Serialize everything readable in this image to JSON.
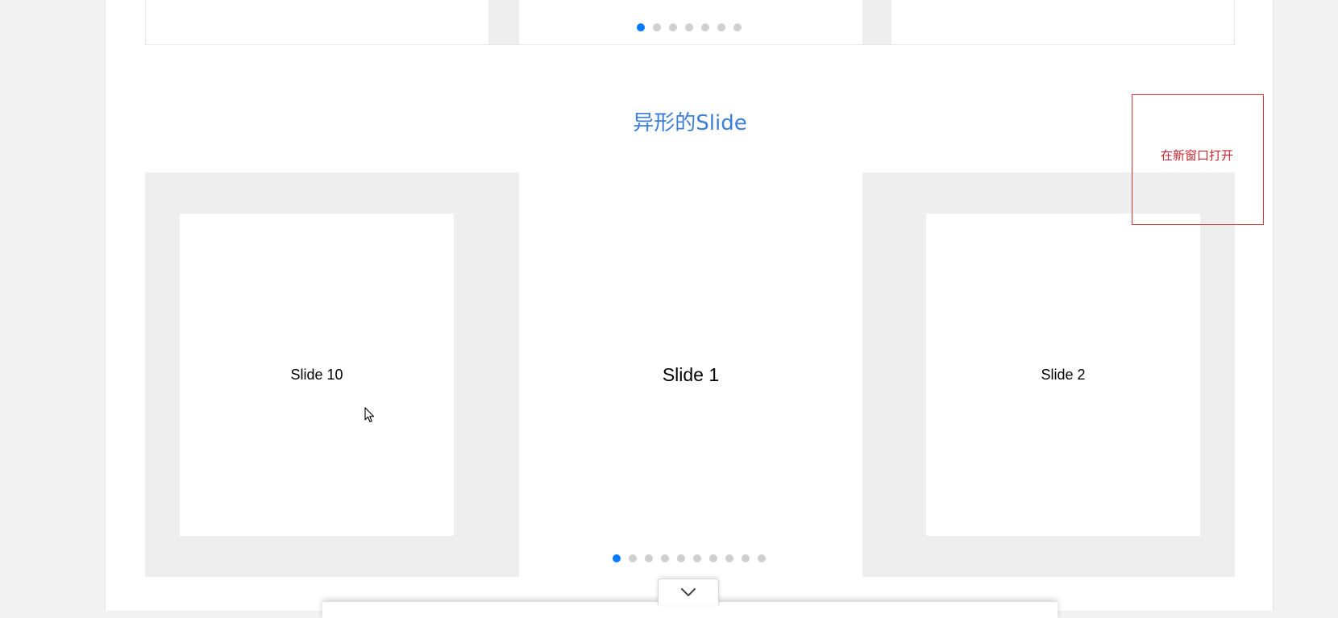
{
  "top_carousel": {
    "dot_count": 7,
    "active_index": 0
  },
  "section": {
    "title": "异形的Slide"
  },
  "open_link": {
    "label": "在新窗口打开"
  },
  "main_carousel": {
    "slides": [
      {
        "label": "Slide 10"
      },
      {
        "label": "Slide 1"
      },
      {
        "label": "Slide 2"
      }
    ],
    "dot_count": 10,
    "active_index": 0
  },
  "colors": {
    "accent": "#007aff",
    "title": "#3b7dd8",
    "link": "#c8252e",
    "frame": "#e0313a",
    "dot_inactive": "#cfcfcf",
    "carousel_bg": "#eeeeee"
  },
  "icons": {
    "toggle": "chevron-down-icon",
    "cursor": "mouse-pointer-icon"
  }
}
